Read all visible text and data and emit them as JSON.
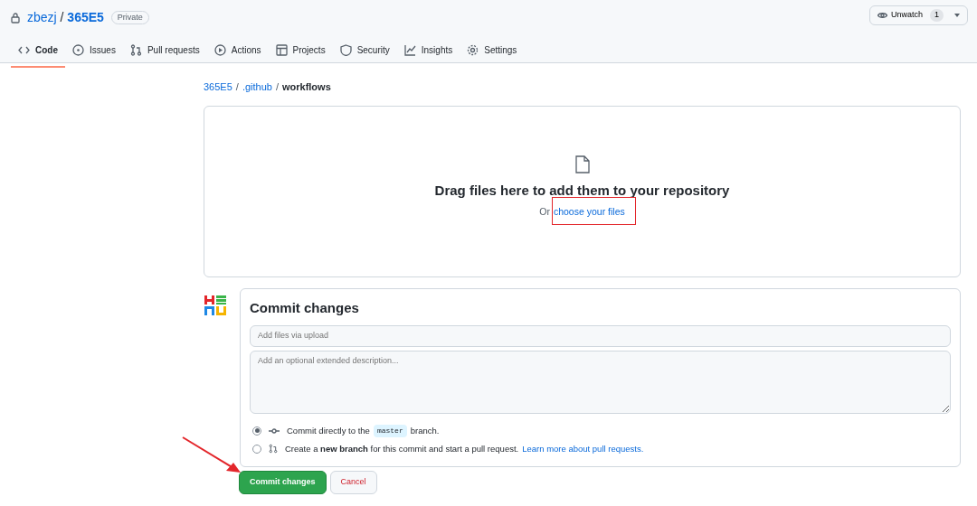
{
  "repo": {
    "owner": "zbezj",
    "separator": "/",
    "name": "365E5",
    "visibility": "Private"
  },
  "watch": {
    "label": "Unwatch",
    "count": "1"
  },
  "tabs": [
    {
      "label": "Code",
      "selected": true
    },
    {
      "label": "Issues",
      "selected": false
    },
    {
      "label": "Pull requests",
      "selected": false
    },
    {
      "label": "Actions",
      "selected": false
    },
    {
      "label": "Projects",
      "selected": false
    },
    {
      "label": "Security",
      "selected": false
    },
    {
      "label": "Insights",
      "selected": false
    },
    {
      "label": "Settings",
      "selected": false
    }
  ],
  "breadcrumb": [
    {
      "kind": "link",
      "label": "365E5"
    },
    {
      "kind": "separator",
      "label": "/"
    },
    {
      "kind": "link",
      "label": ".github"
    },
    {
      "kind": "separator",
      "label": "/"
    },
    {
      "kind": "current",
      "label": "workflows"
    }
  ],
  "dropzone": {
    "title": "Drag files here to add them to your repository",
    "prefix": "Or",
    "link": "choose your files"
  },
  "commit": {
    "title": "Commit changes",
    "summary": {
      "placeholder": "Add files via upload"
    },
    "description": {
      "placeholder": "Add an optional extended description..."
    },
    "options": [
      {
        "kind": "direct",
        "selected": true,
        "text_before": "Commit directly to the",
        "branch": "master",
        "text_after": "branch."
      },
      {
        "kind": "new_branch",
        "selected": false,
        "text": "Create a **new branch** for this commit and start a pull request.",
        "link": "Learn more about pull requests."
      }
    ],
    "buttons": [
      {
        "kind": "primary",
        "label": "Commit changes"
      },
      {
        "kind": "secondary",
        "label": "Cancel"
      }
    ]
  }
}
